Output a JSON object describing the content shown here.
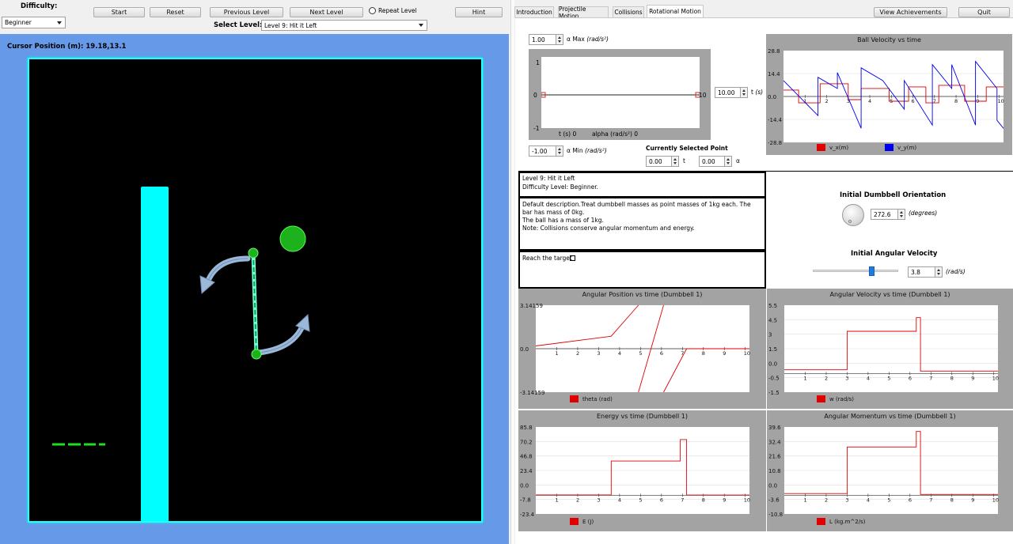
{
  "toolbar": {
    "difficulty_label": "Difficulty:",
    "difficulty_value": "Beginner",
    "start": "Start",
    "reset": "Reset",
    "previous_level": "Previous Level",
    "next_level": "Next Level",
    "repeat_level": "Repeat Level",
    "hint": "Hint",
    "select_level_label": "Select Level:",
    "select_level_value": "Level 9: Hit it Left"
  },
  "cursor": {
    "label": "Cursor Position (m): 19.18,13.1"
  },
  "tabs": [
    "Introduction",
    "Projectile Motion",
    "Collisions",
    "Rotational Motion"
  ],
  "active_tab": "Rotational Motion",
  "top_buttons": {
    "achievements": "View Achievements",
    "quit": "Quit"
  },
  "alpha_editor": {
    "max_value": "1.00",
    "max_label": "α Max",
    "max_unit": "(rad/s²)",
    "min_value": "-1.00",
    "min_label": "α Min",
    "min_unit": "(rad/s²)",
    "t_value": "10.00",
    "t_label": "t",
    "t_unit": "(s)",
    "y_top": "1",
    "y_mid": "0",
    "y_bot": "-1",
    "x_right": "10",
    "readout_t": "t (s) 0",
    "readout_alpha": "alpha (rad/s²) 0",
    "selected_point_label": "Currently Selected Point",
    "sel_t_value": "0.00",
    "sel_t_label": "t",
    "sel_a_value": "0.00",
    "sel_a_label": "α"
  },
  "level_info": {
    "name": "Level 9: Hit it Left",
    "difficulty": "Difficulty Level: Beginner.",
    "description": [
      "Default description.Treat dumbbell masses as point masses of 1kg each. The bar has mass of 0kg.",
      "The ball has a mass of 1kg.",
      "Note: Collisions conserve angular momentum and energy."
    ],
    "goal": "Reach the target"
  },
  "orientation": {
    "title": "Initial Dumbbell Orientation",
    "value": "272.6",
    "unit": "(degrees)"
  },
  "angular_velocity": {
    "title": "Initial Angular Velocity",
    "value": "3.8",
    "unit": "(rad/s)",
    "slider_fraction": 0.7
  },
  "colors": {
    "background_blue": "#6699e8",
    "cyan": "#00ffff",
    "green": "#22cc22",
    "red": "#e00000",
    "blue": "#0000ee",
    "chart_gray": "#a3a3a3"
  },
  "chart_data": [
    {
      "id": "ball_velocity",
      "type": "line",
      "title": "Ball Velocity vs time",
      "ylim": [
        -28.8,
        28.8
      ],
      "y_ticks": [
        "28.8",
        "14.4",
        "0.0",
        "-14.4",
        "-28.8",
        "-28.8"
      ],
      "x_ticks": [
        "1",
        "2",
        "3",
        "4",
        "5",
        "6",
        "7",
        "8",
        "9",
        "10"
      ],
      "xlim": [
        0,
        10.2
      ],
      "series": [
        {
          "name": "v_x(m)",
          "color": "#e00000",
          "x": [
            0,
            0.7,
            0.7,
            1.7,
            1.7,
            3,
            3,
            3.6,
            3.6,
            4.9,
            4.9,
            5.8,
            5.8,
            6.6,
            6.6,
            7.2,
            7.2,
            8.4,
            8.4,
            9.4,
            9.4,
            10.2
          ],
          "y": [
            4,
            4,
            -4,
            -4,
            8,
            8,
            -2,
            -2,
            5,
            5,
            -3,
            -3,
            6,
            6,
            -4,
            -4,
            7,
            7,
            -3,
            -3,
            6,
            6
          ]
        },
        {
          "name": "v_y(m)",
          "color": "#0000ee",
          "x": [
            0,
            1.6,
            1.6,
            2.5,
            2.5,
            3.6,
            3.6,
            4.6,
            4.6,
            5.6,
            5.6,
            6.9,
            6.9,
            7.8,
            7.8,
            8.9,
            8.9,
            9.9,
            9.9,
            10.2
          ],
          "y": [
            10,
            -12,
            12,
            5,
            15,
            -20,
            18,
            10,
            10,
            -8,
            10,
            -18,
            20,
            5,
            20,
            -18,
            22,
            5,
            -15,
            -20
          ]
        }
      ]
    },
    {
      "id": "angular_position",
      "type": "line",
      "title": "Angular Position vs time (Dumbbell 1)",
      "ylim": [
        -3.14159,
        3.14159
      ],
      "y_ticks": [
        "3.14159",
        "0.0",
        "-3.14159"
      ],
      "x_ticks": [
        "1",
        "2",
        "3",
        "4",
        "5",
        "6",
        "7",
        "8",
        "9",
        "10"
      ],
      "xlim": [
        0,
        10.2
      ],
      "series": [
        {
          "name": "theta (rad)",
          "color": "#e00000",
          "x": [
            0,
            3.6,
            4.9,
            null,
            4.9,
            6.1,
            null,
            6.1,
            7.2,
            10.2
          ],
          "y": [
            0.2,
            0.9,
            3.14159,
            null,
            -3.14159,
            3.14159,
            null,
            -3.14159,
            0,
            0
          ]
        }
      ]
    },
    {
      "id": "angular_velocity",
      "type": "line",
      "title": "Angular Velocity vs time (Dumbbell 1)",
      "ylim": [
        -1.5,
        5.5
      ],
      "y_ticks": [
        "5.5",
        "4.5",
        "3",
        "1.5",
        "0.0",
        "-0.5",
        "-1.5"
      ],
      "x_ticks": [
        "1",
        "2",
        "3",
        "4",
        "5",
        "6",
        "7",
        "8",
        "9",
        "10"
      ],
      "xlim": [
        0,
        10.2
      ],
      "series": [
        {
          "name": "w (rad/s)",
          "color": "#e00000",
          "x": [
            0,
            3,
            3,
            6.3,
            6.3,
            6.5,
            6.5,
            10.2
          ],
          "y": [
            0.3,
            0.3,
            3.4,
            3.4,
            4.5,
            4.5,
            0.2,
            0.2
          ]
        }
      ]
    },
    {
      "id": "energy",
      "type": "line",
      "title": "Energy vs time (Dumbbell 1)",
      "ylim": [
        -23.4,
        85.8
      ],
      "y_ticks": [
        "85.8",
        "70.2",
        "46.8",
        "23.4",
        "0.0",
        "-7.8",
        "-23.4"
      ],
      "x_ticks": [
        "1",
        "2",
        "3",
        "4",
        "5",
        "6",
        "7",
        "8",
        "9",
        "10"
      ],
      "xlim": [
        0,
        10.2
      ],
      "series": [
        {
          "name": "E (J)",
          "color": "#e00000",
          "x": [
            0,
            3.6,
            3.6,
            6.9,
            6.9,
            7.2,
            7.2,
            10.2
          ],
          "y": [
            0.5,
            0.5,
            43,
            43,
            70,
            70,
            0.3,
            0.3
          ]
        }
      ]
    },
    {
      "id": "angular_momentum",
      "type": "line",
      "title": "Angular Momentum vs time (Dumbbell 1)",
      "ylim": [
        -10.8,
        39.6
      ],
      "y_ticks": [
        "39.6",
        "32.4",
        "21.6",
        "10.8",
        "0.0",
        "-3.6",
        "-10.8"
      ],
      "x_ticks": [
        "1",
        "2",
        "3",
        "4",
        "5",
        "6",
        "7",
        "8",
        "9",
        "10"
      ],
      "xlim": [
        0,
        10.2
      ],
      "series": [
        {
          "name": "L (kg.m^2/s)",
          "color": "#e00000",
          "x": [
            0,
            3,
            3,
            6.3,
            6.3,
            6.5,
            6.5,
            10.2
          ],
          "y": [
            1,
            1,
            28,
            28,
            37,
            37,
            0.5,
            0.5
          ]
        }
      ]
    }
  ]
}
